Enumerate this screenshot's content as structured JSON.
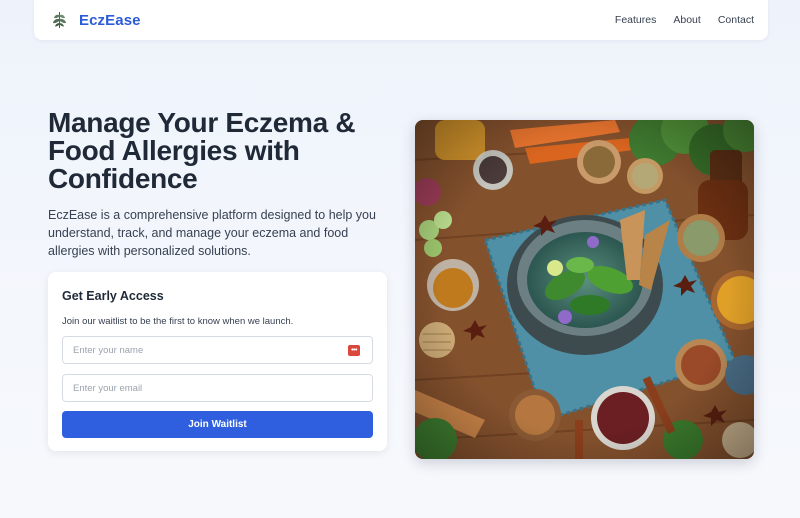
{
  "nav": {
    "brand": "EczEase",
    "logo_icon": "herb-leaf-icon",
    "links": [
      "Features",
      "About",
      "Contact"
    ]
  },
  "hero": {
    "title": "Manage Your Eczema & Food Allergies with Confidence",
    "subtitle": "EczEase is a comprehensive platform designed to help you understand, track, and manage your eczema and food allergies with personalized solutions.",
    "image_icon": "herbs-and-spices-photo"
  },
  "waitlist": {
    "title": "Get Early Access",
    "description": "Join our waitlist to be the first to know when we launch.",
    "name_placeholder": "Enter your name",
    "email_placeholder": "Enter your email",
    "autofill_icon": "password-autofill-icon",
    "button_label": "Join Waitlist"
  },
  "colors": {
    "brand": "#2b5bd7",
    "button": "#2f5fdf",
    "background": "#eef3fb"
  }
}
